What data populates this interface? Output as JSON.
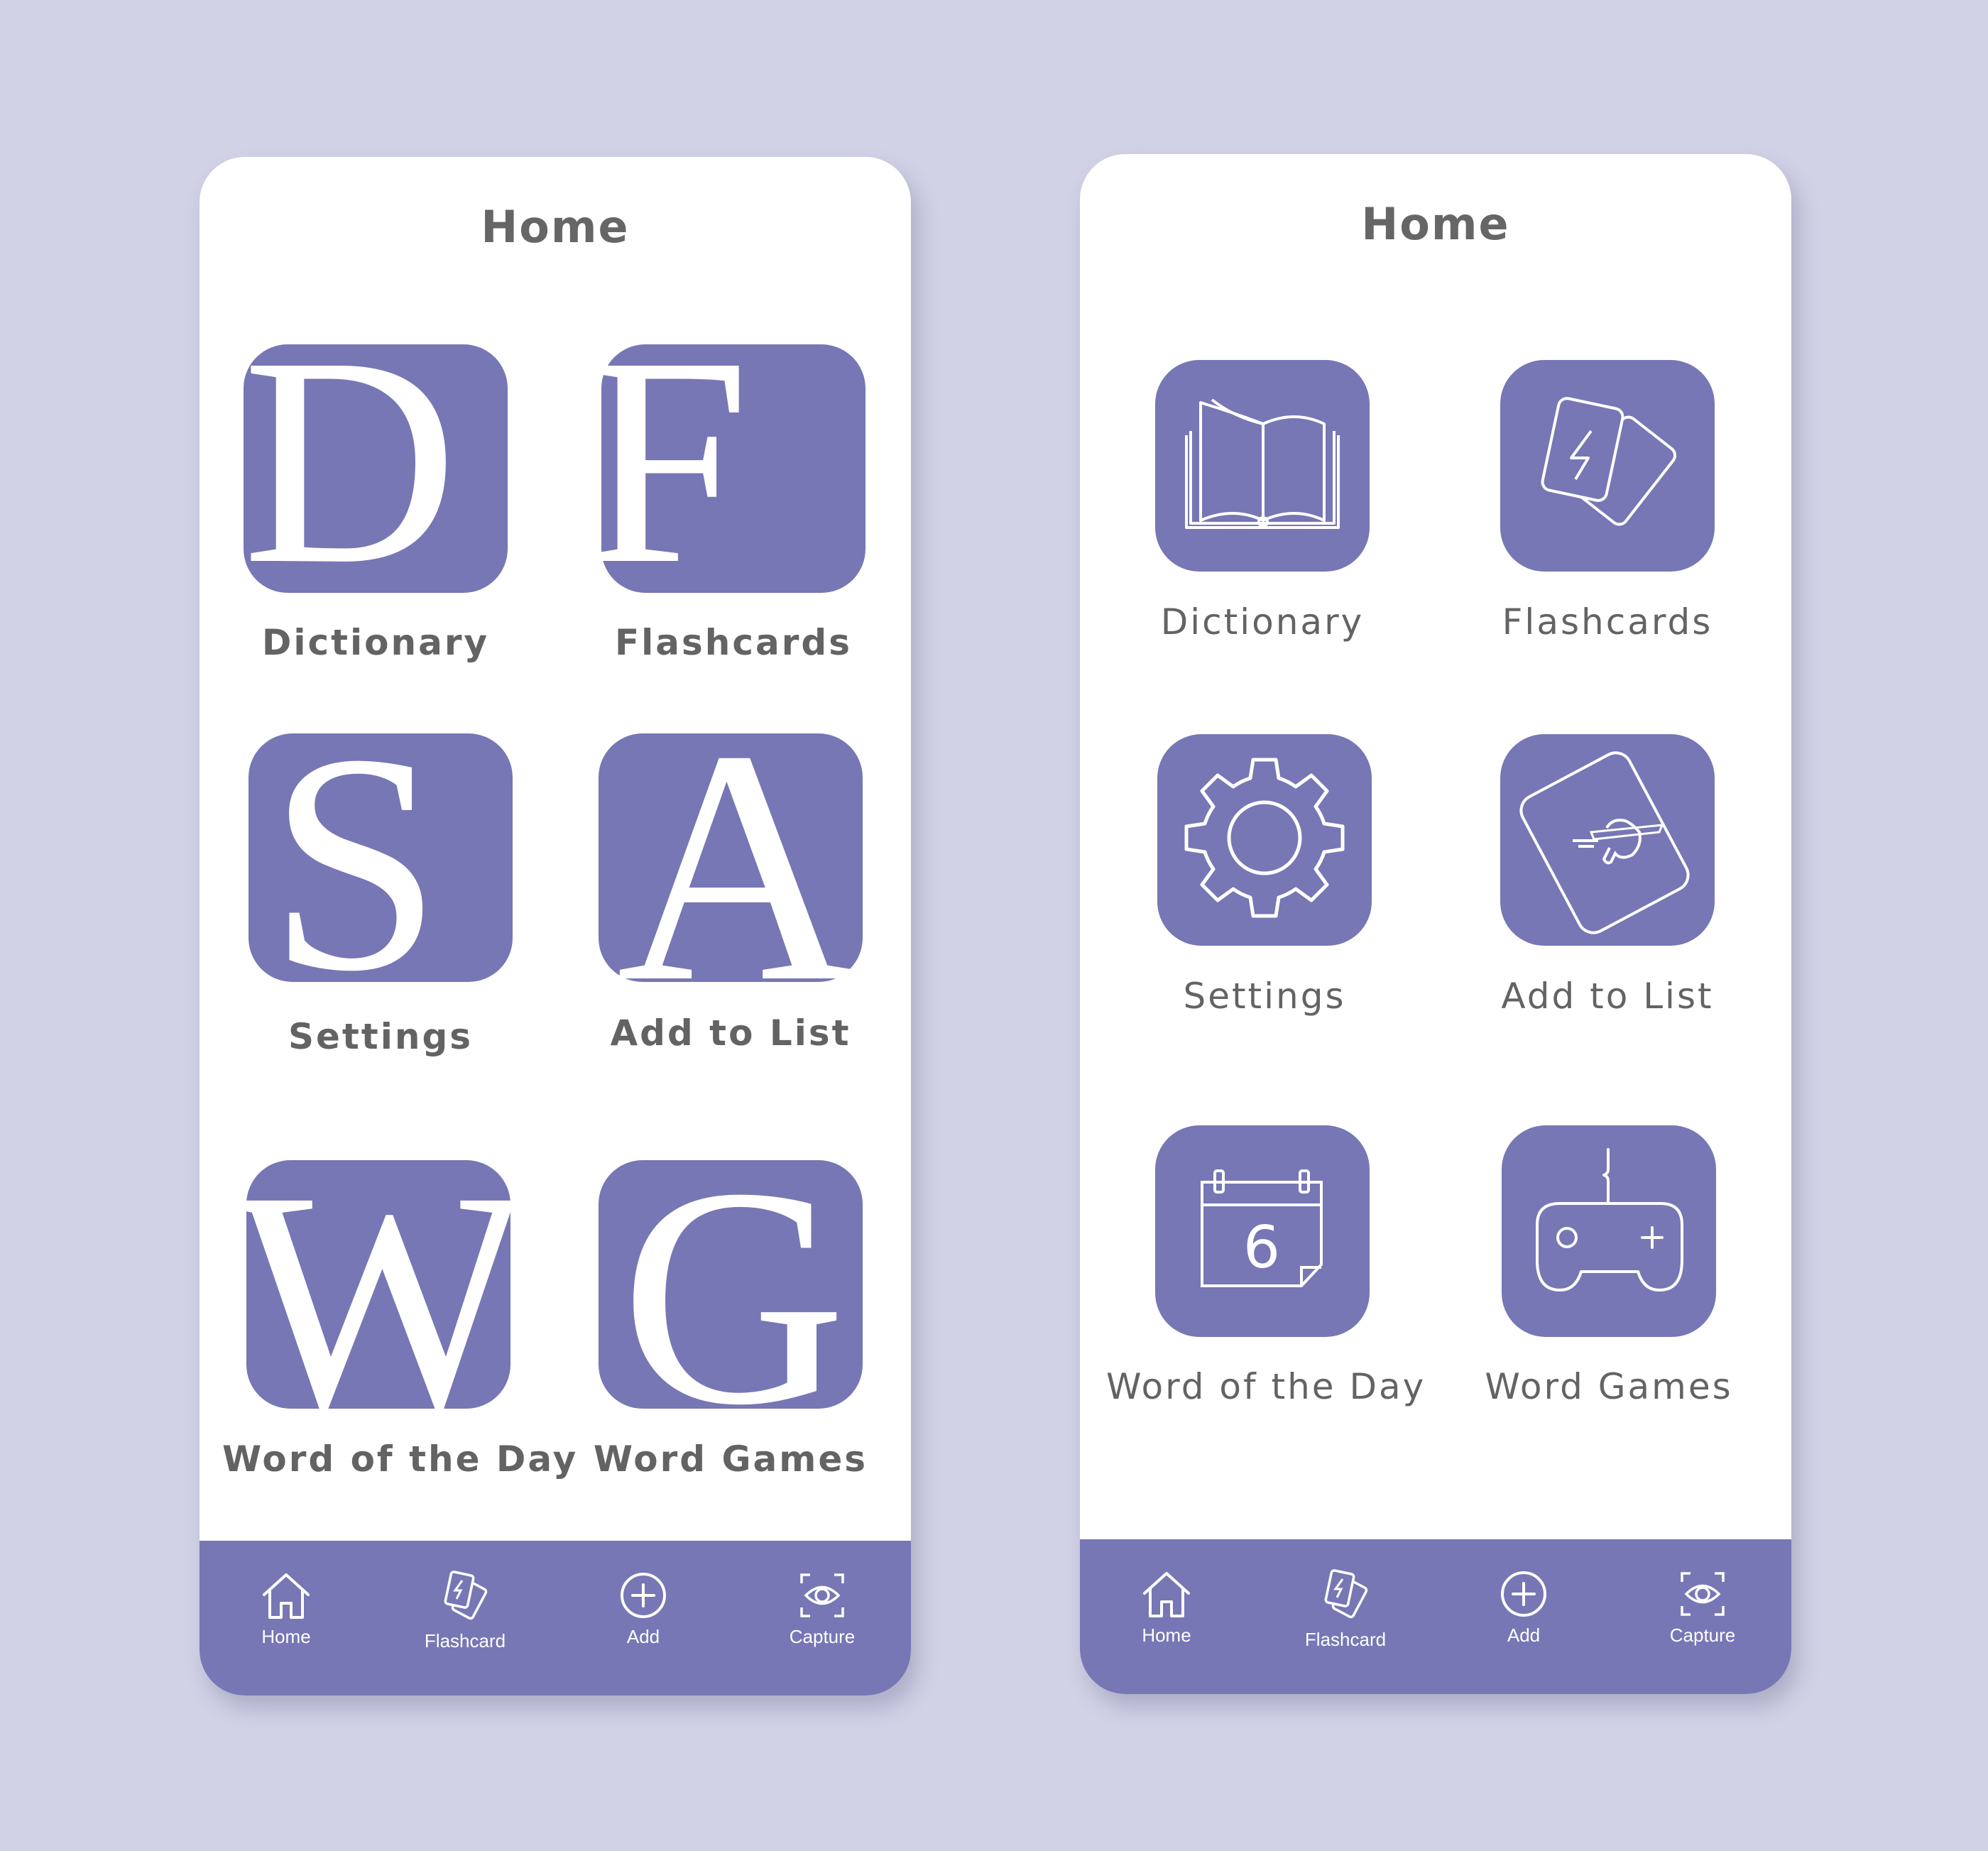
{
  "colors": {
    "background": "#d1d2e6",
    "accent": "#7777b5",
    "text": "#636363",
    "card": "#ffffff"
  },
  "screens": [
    {
      "title": "Home",
      "tiles": [
        {
          "label": "Dictionary",
          "glyph": "D"
        },
        {
          "label": "Flashcards",
          "glyph": "F"
        },
        {
          "label": "Settings",
          "glyph": "S"
        },
        {
          "label": "Add to List",
          "glyph": "A"
        },
        {
          "label": "Word of the Day",
          "glyph": "W"
        },
        {
          "label": "Word Games",
          "glyph": "G"
        }
      ],
      "nav": [
        {
          "label": "Home",
          "icon": "home-icon"
        },
        {
          "label": "Flashcard",
          "icon": "flashcard-icon"
        },
        {
          "label": "Add",
          "icon": "add-circle-icon"
        },
        {
          "label": "Capture",
          "icon": "capture-eye-icon"
        }
      ]
    },
    {
      "title": "Home",
      "tiles": [
        {
          "label": "Dictionary",
          "icon": "open-book-icon"
        },
        {
          "label": "Flashcards",
          "icon": "flashcards-lightning-icon"
        },
        {
          "label": "Settings",
          "icon": "gear-icon"
        },
        {
          "label": "Add to List",
          "icon": "hand-writing-card-icon"
        },
        {
          "label": "Word of the Day",
          "icon": "calendar-icon",
          "calendar_number": "6"
        },
        {
          "label": "Word Games",
          "icon": "gamepad-icon"
        }
      ],
      "nav": [
        {
          "label": "Home",
          "icon": "home-icon"
        },
        {
          "label": "Flashcard",
          "icon": "flashcard-icon"
        },
        {
          "label": "Add",
          "icon": "add-circle-icon"
        },
        {
          "label": "Capture",
          "icon": "capture-eye-icon"
        }
      ]
    }
  ]
}
